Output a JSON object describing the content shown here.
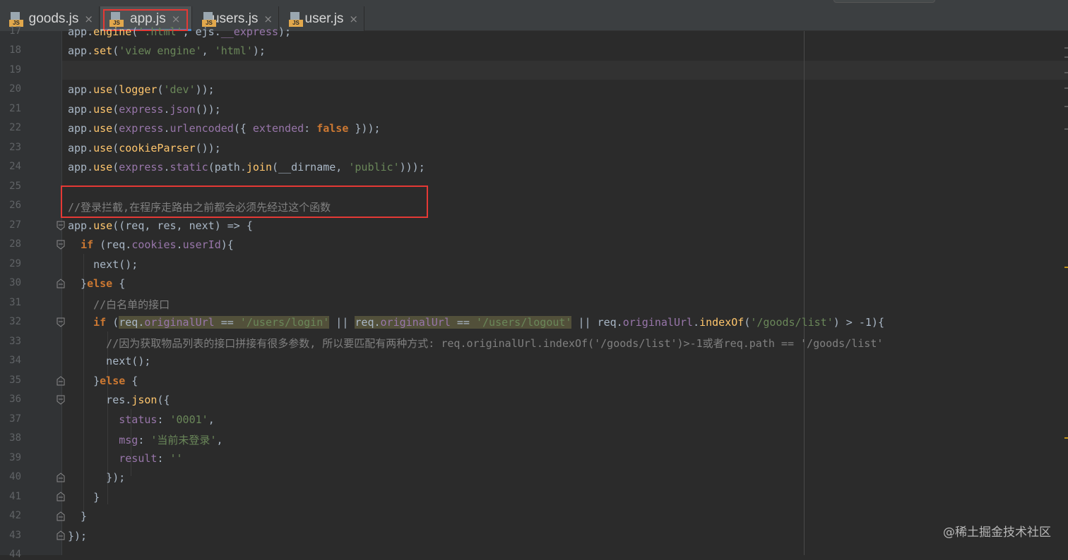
{
  "tabs": [
    {
      "name": "goods.js",
      "icon": "js-file-icon",
      "active": false
    },
    {
      "name": "app.js",
      "icon": "js-file-icon",
      "active": true
    },
    {
      "name": "users.js",
      "icon": "js-file-icon",
      "active": false
    },
    {
      "name": "user.js",
      "icon": "js-file-icon",
      "active": false
    }
  ],
  "tab_icon_label": "JS",
  "close_glyph": "×",
  "line_numbers": [
    "17",
    "18",
    "19",
    "20",
    "21",
    "22",
    "23",
    "24",
    "25",
    "26",
    "27",
    "28",
    "29",
    "30",
    "31",
    "32",
    "33",
    "34",
    "35",
    "36",
    "37",
    "38",
    "39",
    "40",
    "41",
    "42",
    "43",
    "44"
  ],
  "code": {
    "l17": "app.engine('.html', ejs.__express);",
    "l18": "app.set('view engine', 'html');",
    "l20": "app.use(logger('dev'));",
    "l21": "app.use(express.json());",
    "l22": "app.use(express.urlencoded({ extended: false }));",
    "l23": "app.use(cookieParser());",
    "l24": "app.use(express.static(path.join(__dirname, 'public')));",
    "l26": "//登录拦截,在程序走路由之前都会必须先经过这个函数",
    "l27": "app.use((req, res, next) => {",
    "l28": "  if (req.cookies.userId){",
    "l29": "    next();",
    "l30": "  }else {",
    "l31": "    //白名单的接口",
    "l32": "    if (req.originalUrl == '/users/login' || req.originalUrl == '/users/logout' || req.originalUrl.indexOf('/goods/list') > -1){",
    "l33": "      //因为获取物品列表的接口拼接有很多参数, 所以要匹配有两种方式: req.originalUrl.indexOf('/goods/list')>-1或者req.path == '/goods/list'",
    "l34": "      next();",
    "l35": "    }else {",
    "l36": "      res.json({",
    "l37": "        status: '0001',",
    "l38": "        msg: '当前未登录',",
    "l39": "        result: ''",
    "l40": "      });",
    "l41": "    }",
    "l42": "  }",
    "l43": "});"
  },
  "watermark": "@稀土掘金技术社区",
  "colors": {
    "background": "#2b2b2b",
    "keyword": "#cc7832",
    "string": "#6a8759",
    "function": "#ffc66d",
    "property": "#9876aa",
    "comment": "#808080",
    "annotation_box": "#e53935"
  }
}
